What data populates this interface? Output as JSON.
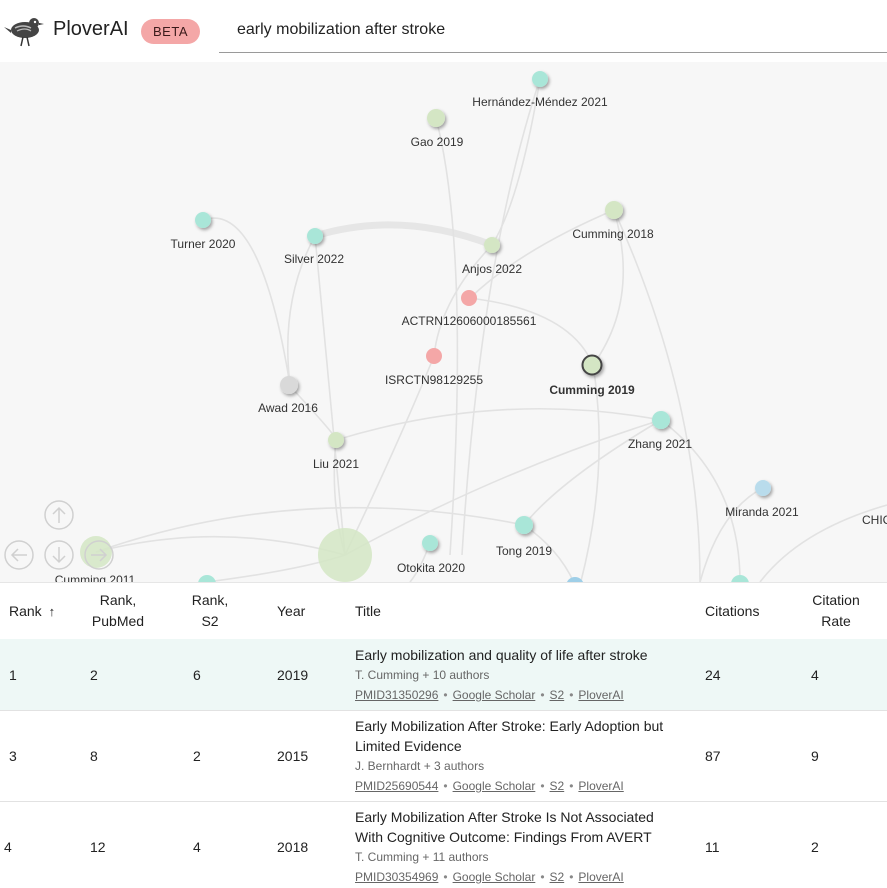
{
  "header": {
    "app_name": "PloverAI",
    "beta_badge": "BETA",
    "search_value": "early mobilization after stroke"
  },
  "graph": {
    "nodes": [
      {
        "label": "Hernández-Méndez 2021",
        "color": "#a9e6d8"
      },
      {
        "label": "Gao 2019",
        "color": "#d4e6c4"
      },
      {
        "label": "Turner 2020",
        "color": "#a9e6d8"
      },
      {
        "label": "Silver 2022",
        "color": "#a9e6d8"
      },
      {
        "label": "Anjos 2022",
        "color": "#d4e6c4"
      },
      {
        "label": "Cumming 2018",
        "color": "#d4e6c4"
      },
      {
        "label": "ACTRN12606000185561",
        "color": "#f4a7a7"
      },
      {
        "label": "ISRCTN98129255",
        "color": "#f4a7a7"
      },
      {
        "label": "Cumming 2019",
        "color": "#d4e6c4",
        "selected": true
      },
      {
        "label": "Awad 2016",
        "color": "#d9d9d9"
      },
      {
        "label": "Zhang 2021",
        "color": "#a9e6d8"
      },
      {
        "label": "Liu 2021",
        "color": "#d4e6c4"
      },
      {
        "label": "Miranda 2021",
        "color": "#b9dcec"
      },
      {
        "label": "CHIC",
        "color": "#a9e6d8"
      },
      {
        "label": "Tong 2019",
        "color": "#a9e6d8"
      },
      {
        "label": "Otokita 2020",
        "color": "#a9e6d8"
      },
      {
        "label": "Cumming 2011",
        "color": "#d4e6c4"
      }
    ]
  },
  "table": {
    "headers": {
      "rank": "Rank",
      "rank_pubmed_1": "Rank,",
      "rank_pubmed_2": "PubMed",
      "rank_s2_1": "Rank,",
      "rank_s2_2": "S2",
      "year": "Year",
      "title": "Title",
      "citations": "Citations",
      "rate_1": "Citation",
      "rate_2": "Rate",
      "sort_arrow": "↑"
    },
    "link_labels": {
      "scholar": "Google Scholar",
      "s2": "S2",
      "plover": "PloverAI"
    },
    "rows": [
      {
        "rank": "1",
        "rank_pubmed": "2",
        "rank_s2": "6",
        "year": "2019",
        "title": "Early mobilization and quality of life after stroke",
        "authors": "T. Cumming + 10 authors",
        "pmid": "PMID31350296",
        "citations": "24",
        "rate": "4"
      },
      {
        "rank": "3",
        "rank_pubmed": "8",
        "rank_s2": "2",
        "year": "2015",
        "title": "Early Mobilization After Stroke: Early Adoption but Limited Evidence",
        "authors": "J. Bernhardt + 3 authors",
        "pmid": "PMID25690544",
        "citations": "87",
        "rate": "9"
      },
      {
        "rank": "4",
        "rank_pubmed": "12",
        "rank_s2": "4",
        "year": "2018",
        "title": "Early Mobilization After Stroke Is Not Associated With Cognitive Outcome: Findings From AVERT",
        "authors": "T. Cumming + 11 authors",
        "pmid": "PMID30354969",
        "citations": "11",
        "rate": "2"
      }
    ]
  }
}
